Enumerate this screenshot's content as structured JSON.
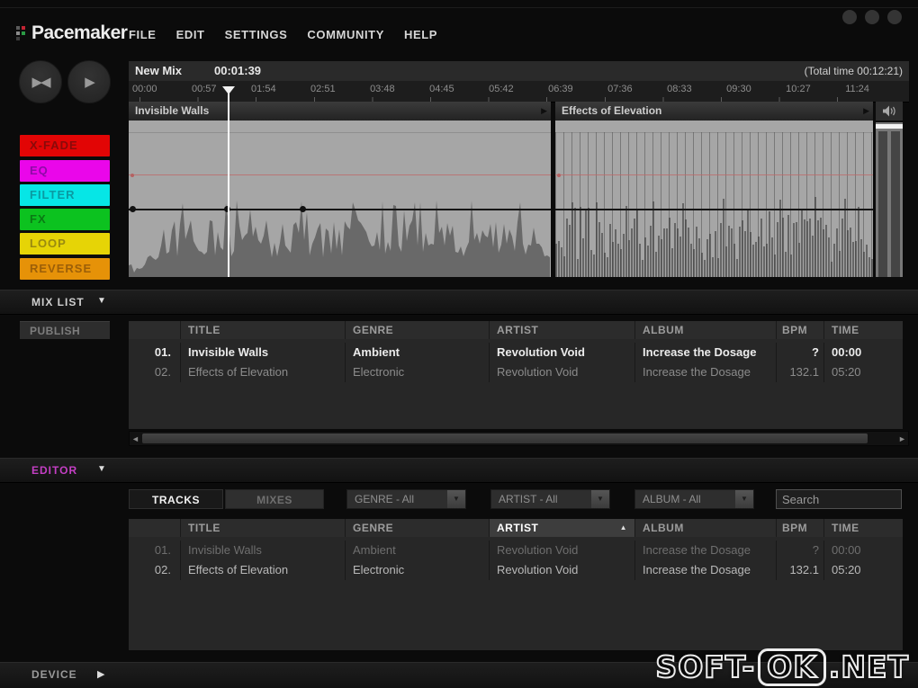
{
  "app": {
    "logo_text": "Pacemaker",
    "menu": [
      "FILE",
      "EDIT",
      "SETTINGS",
      "COMMUNITY",
      "HELP"
    ]
  },
  "icons": {
    "skip": "▶◀",
    "play": "▶",
    "track_arrow": "▶",
    "dropdown_arrow": "▼",
    "section_collapse": "▼",
    "section_expand": "▶",
    "sort_asc": "▲",
    "scroll_left": "◄",
    "scroll_right": "►"
  },
  "timeline": {
    "mix_name": "New Mix",
    "current_time": "00:01:39",
    "total_time_label": "(Total time 00:12:21)",
    "ticks": [
      "00:00",
      "00:57",
      "01:54",
      "02:51",
      "03:48",
      "04:45",
      "05:42",
      "06:39",
      "07:36",
      "08:33",
      "09:30",
      "10:27",
      "11:24"
    ],
    "tracks": [
      {
        "name": "Invisible Walls"
      },
      {
        "name": "Effects of Elevation"
      }
    ]
  },
  "effect_buttons": [
    {
      "label": "X-FADE",
      "bg": "#e20505",
      "fg": "#8a0a0a"
    },
    {
      "label": "EQ",
      "bg": "#ea06ea",
      "fg": "#8f0aa8"
    },
    {
      "label": "FILTER",
      "bg": "#06e6e6",
      "fg": "#0a9aa2"
    },
    {
      "label": "FX",
      "bg": "#0cc21f",
      "fg": "#0a7a14"
    },
    {
      "label": "LOOP",
      "bg": "#e6d406",
      "fg": "#998a10"
    },
    {
      "label": "REVERSE",
      "bg": "#e69208",
      "fg": "#9c5f08"
    }
  ],
  "mix_list": {
    "title": "MIX LIST",
    "publish_label": "PUBLISH",
    "columns": [
      "",
      "TITLE",
      "GENRE",
      "ARTIST",
      "ALBUM",
      "BPM",
      "TIME"
    ],
    "rows": [
      {
        "num": "01.",
        "title": "Invisible Walls",
        "genre": "Ambient",
        "artist": "Revolution Void",
        "album": "Increase the Dosage",
        "bpm": "?",
        "time": "00:00"
      },
      {
        "num": "02.",
        "title": "Effects of Elevation",
        "genre": "Electronic",
        "artist": "Revolution Void",
        "album": "Increase the Dosage",
        "bpm": "132.1",
        "time": "05:20"
      }
    ]
  },
  "editor": {
    "title": "EDITOR",
    "tabs": [
      {
        "label": "TRACKS",
        "active": true
      },
      {
        "label": "MIXES",
        "active": false
      }
    ],
    "filters": {
      "genre": "GENRE - All",
      "artist": "ARTIST - All",
      "album": "ALBUM - All"
    },
    "search_placeholder": "Search",
    "columns": [
      "",
      "TITLE",
      "GENRE",
      "ARTIST",
      "ALBUM",
      "BPM",
      "TIME"
    ],
    "sort_column": "ARTIST",
    "rows": [
      {
        "num": "01.",
        "title": "Invisible Walls",
        "genre": "Ambient",
        "artist": "Revolution Void",
        "album": "Increase the Dosage",
        "bpm": "?",
        "time": "00:00"
      },
      {
        "num": "02.",
        "title": "Effects of Elevation",
        "genre": "Electronic",
        "artist": "Revolution Void",
        "album": "Increase the Dosage",
        "bpm": "132.1",
        "time": "05:20"
      }
    ]
  },
  "device": {
    "title": "DEVICE"
  },
  "watermark": {
    "prefix": "SOFT-",
    "boxed": "OK",
    "suffix": ".NET"
  }
}
